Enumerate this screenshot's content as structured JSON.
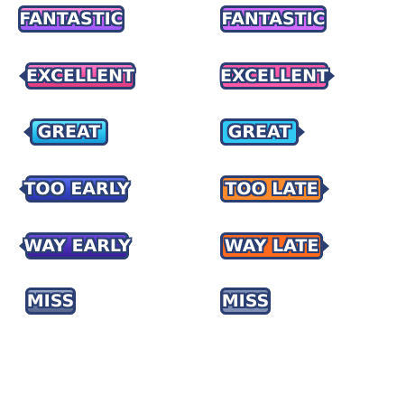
{
  "left_column": {
    "fantastic": "FANTASTIC",
    "excellent": "EXCELLENT",
    "great": "GREAT",
    "too_early": "TOO EARLY",
    "way_early": "WAY EARLY",
    "miss": "MISS"
  },
  "right_column": {
    "fantastic": "FANTASTIC",
    "excellent": "EXCELLENT",
    "great": "GREAT",
    "too_late": "TOO LATE",
    "way_late": "WAY LATE",
    "miss": "MISS"
  },
  "colors": {
    "outline": "#2b3f72",
    "fantastic": "#c466ff",
    "excellent": "#ff4f9a",
    "great": "#28c3f0",
    "too_early": "#3846c9",
    "way_early": "#4a2fb8",
    "too_late": "#ff8a2b",
    "way_late": "#ff6a1f",
    "miss": "#6e7fa8"
  }
}
